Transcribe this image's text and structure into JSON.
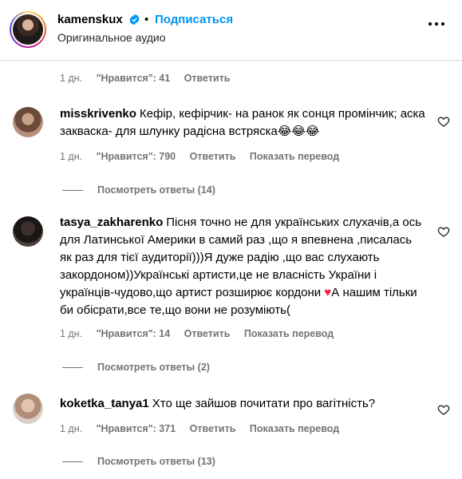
{
  "header": {
    "username": "kamenskux",
    "separator": "•",
    "follow_label": "Подписаться",
    "subtitle": "Оригинальное аудио"
  },
  "first_meta": {
    "time": "1 дн.",
    "likes": "\"Нравится\": 41",
    "reply": "Ответить"
  },
  "comments": [
    {
      "username": "misskrivenko",
      "text": "Кефір, кефірчик- на ранок як сонця промінчик; аска закваска- для шлунку радісна встряска😂😂😂",
      "time": "1 дн.",
      "likes": "\"Нравится\": 790",
      "reply": "Ответить",
      "translate": "Показать перевод",
      "view_replies": "Посмотреть ответы (14)"
    },
    {
      "username": "tasya_zakharenko",
      "text_a": "Пісня точно не для українських слухачів,а ось для Латинської Америки в самий раз ,що я впевнена ,писалась як раз для тієї аудиторії)))Я дуже радію ,що вас слухають закордоном))Українські артисти,це не власність України і українців-чудово,що артист розширює кордони ",
      "heart": "♥",
      "text_b": "А нашим тільки би обісрати,все те,що вони не розуміють(",
      "time": "1 дн.",
      "likes": "\"Нравится\": 14",
      "reply": "Ответить",
      "translate": "Показать перевод",
      "view_replies": "Посмотреть ответы (2)"
    },
    {
      "username": "koketka_tanya1",
      "text": "Хто ще зайшов почитати про вагітність?",
      "time": "1 дн.",
      "likes": "\"Нравится\": 371",
      "reply": "Ответить",
      "translate": "Показать перевод",
      "view_replies": "Посмотреть ответы (13)"
    }
  ],
  "icons": {
    "verified": "verified-badge-icon",
    "more": "more-options-icon",
    "like": "heart-outline-icon"
  },
  "colors": {
    "follow": "#0095f6",
    "verified": "#0095f6",
    "muted": "#737373",
    "heart": "#ed1e3c"
  }
}
